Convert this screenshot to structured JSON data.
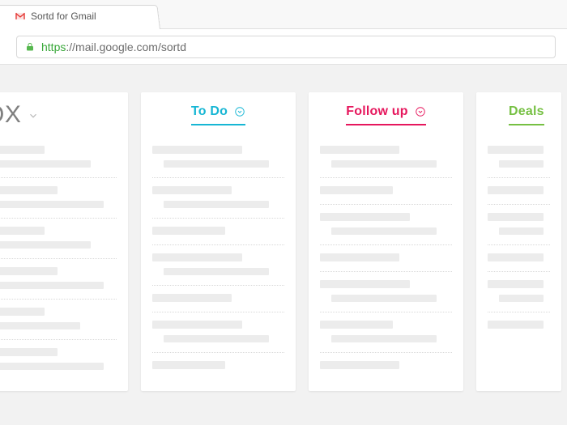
{
  "browser": {
    "tab_title": "Sortd for Gmail",
    "url_protocol": "https",
    "url_display": "://mail.google.com/sortd"
  },
  "columns": {
    "inbox": {
      "title_fragment": "OX"
    },
    "todo": {
      "title": "To Do"
    },
    "followup": {
      "title": "Follow up"
    },
    "deals": {
      "title": "Deals"
    }
  },
  "colors": {
    "todo": "#17b6d4",
    "follow": "#e6175d",
    "deals": "#76c043"
  }
}
